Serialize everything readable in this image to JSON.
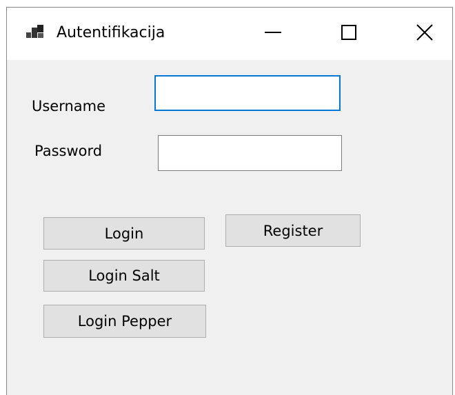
{
  "window": {
    "title": "Autentifikacija",
    "icon": "app-window-icon"
  },
  "caption_buttons": {
    "minimize": "minimize-icon",
    "maximize": "maximize-icon",
    "close": "close-icon"
  },
  "form": {
    "username_label": "Username",
    "username_value": "",
    "password_label": "Password",
    "password_value": ""
  },
  "buttons": {
    "login": "Login",
    "register": "Register",
    "login_salt": "Login Salt",
    "login_pepper": "Login Pepper"
  },
  "colors": {
    "focus_border": "#0078d7",
    "button_face": "#e1e1e1",
    "window_background": "#f0f0f0"
  }
}
